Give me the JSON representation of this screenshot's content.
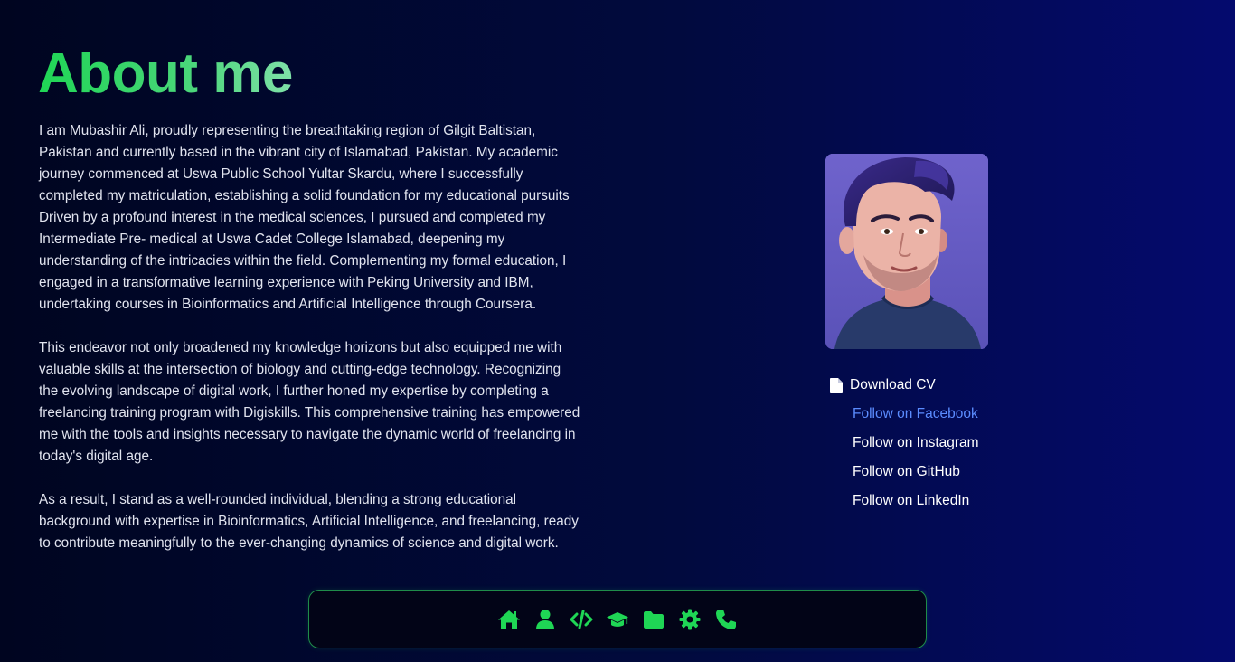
{
  "page": {
    "title": "About me"
  },
  "bio": {
    "paragraphs": [
      "I am Mubashir Ali, proudly representing the breathtaking region of Gilgit Baltistan, Pakistan and currently based in the vibrant city of Islamabad, Pakistan. My academic journey commenced at Uswa Public School Yultar Skardu, where I successfully completed my matriculation, establishing a solid foundation for my educational pursuits Driven by a profound interest in the medical sciences, I pursued and completed my Intermediate Pre- medical at Uswa Cadet College Islamabad, deepening my understanding of the intricacies within the field. Complementing my formal education, I engaged in a transformative learning experience with Peking University and IBM, undertaking courses in Bioinformatics and Artificial Intelligence through Coursera.",
      "This endeavor not only broadened my knowledge horizons but also equipped me with valuable skills at the intersection of biology and cutting-edge technology. Recognizing the evolving landscape of digital work, I further honed my expertise by completing a freelancing training program with Digiskills. This comprehensive training has empowered me with the tools and insights necessary to navigate the dynamic world of freelancing in today's digital age.",
      "As a result, I stand as a well-rounded individual, blending a strong educational background with expertise in Bioinformatics, Artificial Intelligence, and freelancing, ready to contribute meaningfully to the ever-changing dynamics of science and digital work."
    ]
  },
  "profile": {
    "avatar_icon": "avatar-portrait"
  },
  "links": {
    "download_cv": "Download CV",
    "download_icon": "document-icon",
    "facebook": "Follow on Facebook",
    "instagram": "Follow on Instagram",
    "github": "Follow on GitHub",
    "linkedin": "Follow on LinkedIn"
  },
  "nav": {
    "items": [
      "home-icon",
      "user-icon",
      "code-icon",
      "graduation-cap-icon",
      "folder-icon",
      "gear-icon",
      "phone-icon"
    ]
  },
  "colors": {
    "accent_green": "#1fd655",
    "active_link": "#5b8cff",
    "background_left": "#000520",
    "background_right": "#040a6e"
  }
}
